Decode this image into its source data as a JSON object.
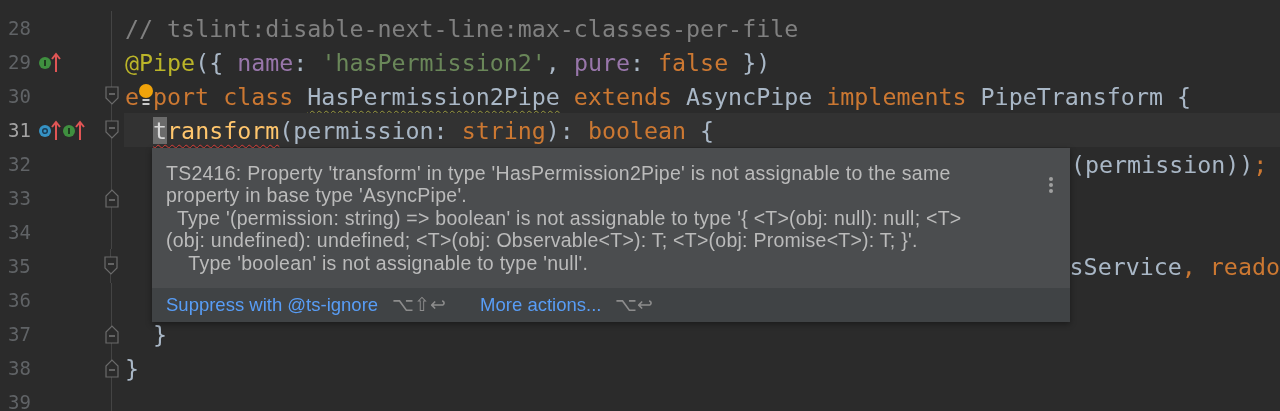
{
  "editor": {
    "lines": [
      {
        "number": "28",
        "current": false,
        "tokens": [
          {
            "kind": "comment",
            "text": "// tslint:disable-next-line:max-classes-per-file"
          }
        ]
      },
      {
        "number": "29",
        "current": false,
        "gutter_icons": [
          {
            "kind": "implements"
          }
        ],
        "tokens": [
          {
            "kind": "decorator",
            "text": "@Pipe"
          },
          {
            "kind": "plain",
            "text": "({ "
          },
          {
            "kind": "property",
            "text": "name"
          },
          {
            "kind": "plain",
            "text": ": "
          },
          {
            "kind": "string",
            "text": "'hasPermission2'"
          },
          {
            "kind": "plain",
            "text": ", "
          },
          {
            "kind": "property",
            "text": "pure"
          },
          {
            "kind": "plain",
            "text": ": "
          },
          {
            "kind": "keyword",
            "text": "false"
          },
          {
            "kind": "plain",
            "text": " })"
          }
        ]
      },
      {
        "number": "30",
        "current": false,
        "fold_start": true,
        "tokens": [
          {
            "kind": "keyword",
            "text": "e"
          },
          {
            "kind": "bulb"
          },
          {
            "kind": "keyword",
            "text": "port class "
          },
          {
            "kind": "plain",
            "text": "HasPermission2Pipe",
            "warning": true
          },
          {
            "kind": "keyword",
            "text": " extends "
          },
          {
            "kind": "plain",
            "text": "AsyncPipe "
          },
          {
            "kind": "keyword",
            "text": "implements "
          },
          {
            "kind": "plain",
            "text": "PipeTransform {"
          }
        ]
      },
      {
        "number": "31",
        "current": true,
        "indented": true,
        "fold_start": true,
        "gutter_icons": [
          {
            "kind": "overrides"
          },
          {
            "kind": "implements"
          }
        ],
        "tokens": [
          {
            "kind": "method",
            "text": "t",
            "error": true,
            "caret": true
          },
          {
            "kind": "method",
            "text": "ransform",
            "error": true
          },
          {
            "kind": "plain",
            "text": "(permission: "
          },
          {
            "kind": "keyword",
            "text": "string"
          },
          {
            "kind": "plain",
            "text": "): "
          },
          {
            "kind": "keyword",
            "text": "boolean"
          },
          {
            "kind": "plain",
            "text": " {"
          }
        ]
      },
      {
        "number": "32",
        "current": false,
        "behind_popup": true,
        "tokens": [
          {
            "kind": "plain",
            "text": "(permission))"
          },
          {
            "kind": "keyword",
            "text": ";"
          }
        ]
      },
      {
        "number": "33",
        "current": false,
        "fold_end": true
      },
      {
        "number": "34",
        "current": false
      },
      {
        "number": "35",
        "current": false,
        "fold_start": true,
        "behind_popup": true,
        "tokens": [
          {
            "kind": "plain",
            "text": "sService"
          },
          {
            "kind": "keyword",
            "text": ", reado"
          }
        ]
      },
      {
        "number": "36",
        "current": false
      },
      {
        "number": "37",
        "current": false,
        "indented": true,
        "fold_end": true,
        "tokens": [
          {
            "kind": "plain",
            "text": "}"
          }
        ]
      },
      {
        "number": "38",
        "current": false,
        "fold_end": true,
        "tokens": [
          {
            "kind": "plain",
            "text": "}"
          }
        ]
      },
      {
        "number": "39",
        "current": false
      }
    ]
  },
  "error_popup": {
    "message": [
      "TS2416: Property 'transform' in type 'HasPermission2Pipe' is not assignable to the same",
      "property in base type 'AsyncPipe'.",
      "  Type '(permission: string) => boolean' is not assignable to type '{ <T>(obj: null): null; <T>",
      "(obj: undefined): undefined; <T>(obj: Observable<T>): T; <T>(obj: Promise<T>): T; }'.",
      "    Type 'boolean' is not assignable to type 'null'."
    ],
    "actions": [
      {
        "label": "Suppress with @ts-ignore",
        "shortcut": "⌥⇧↩"
      },
      {
        "label": "More actions...",
        "shortcut": "⌥↩"
      }
    ]
  }
}
